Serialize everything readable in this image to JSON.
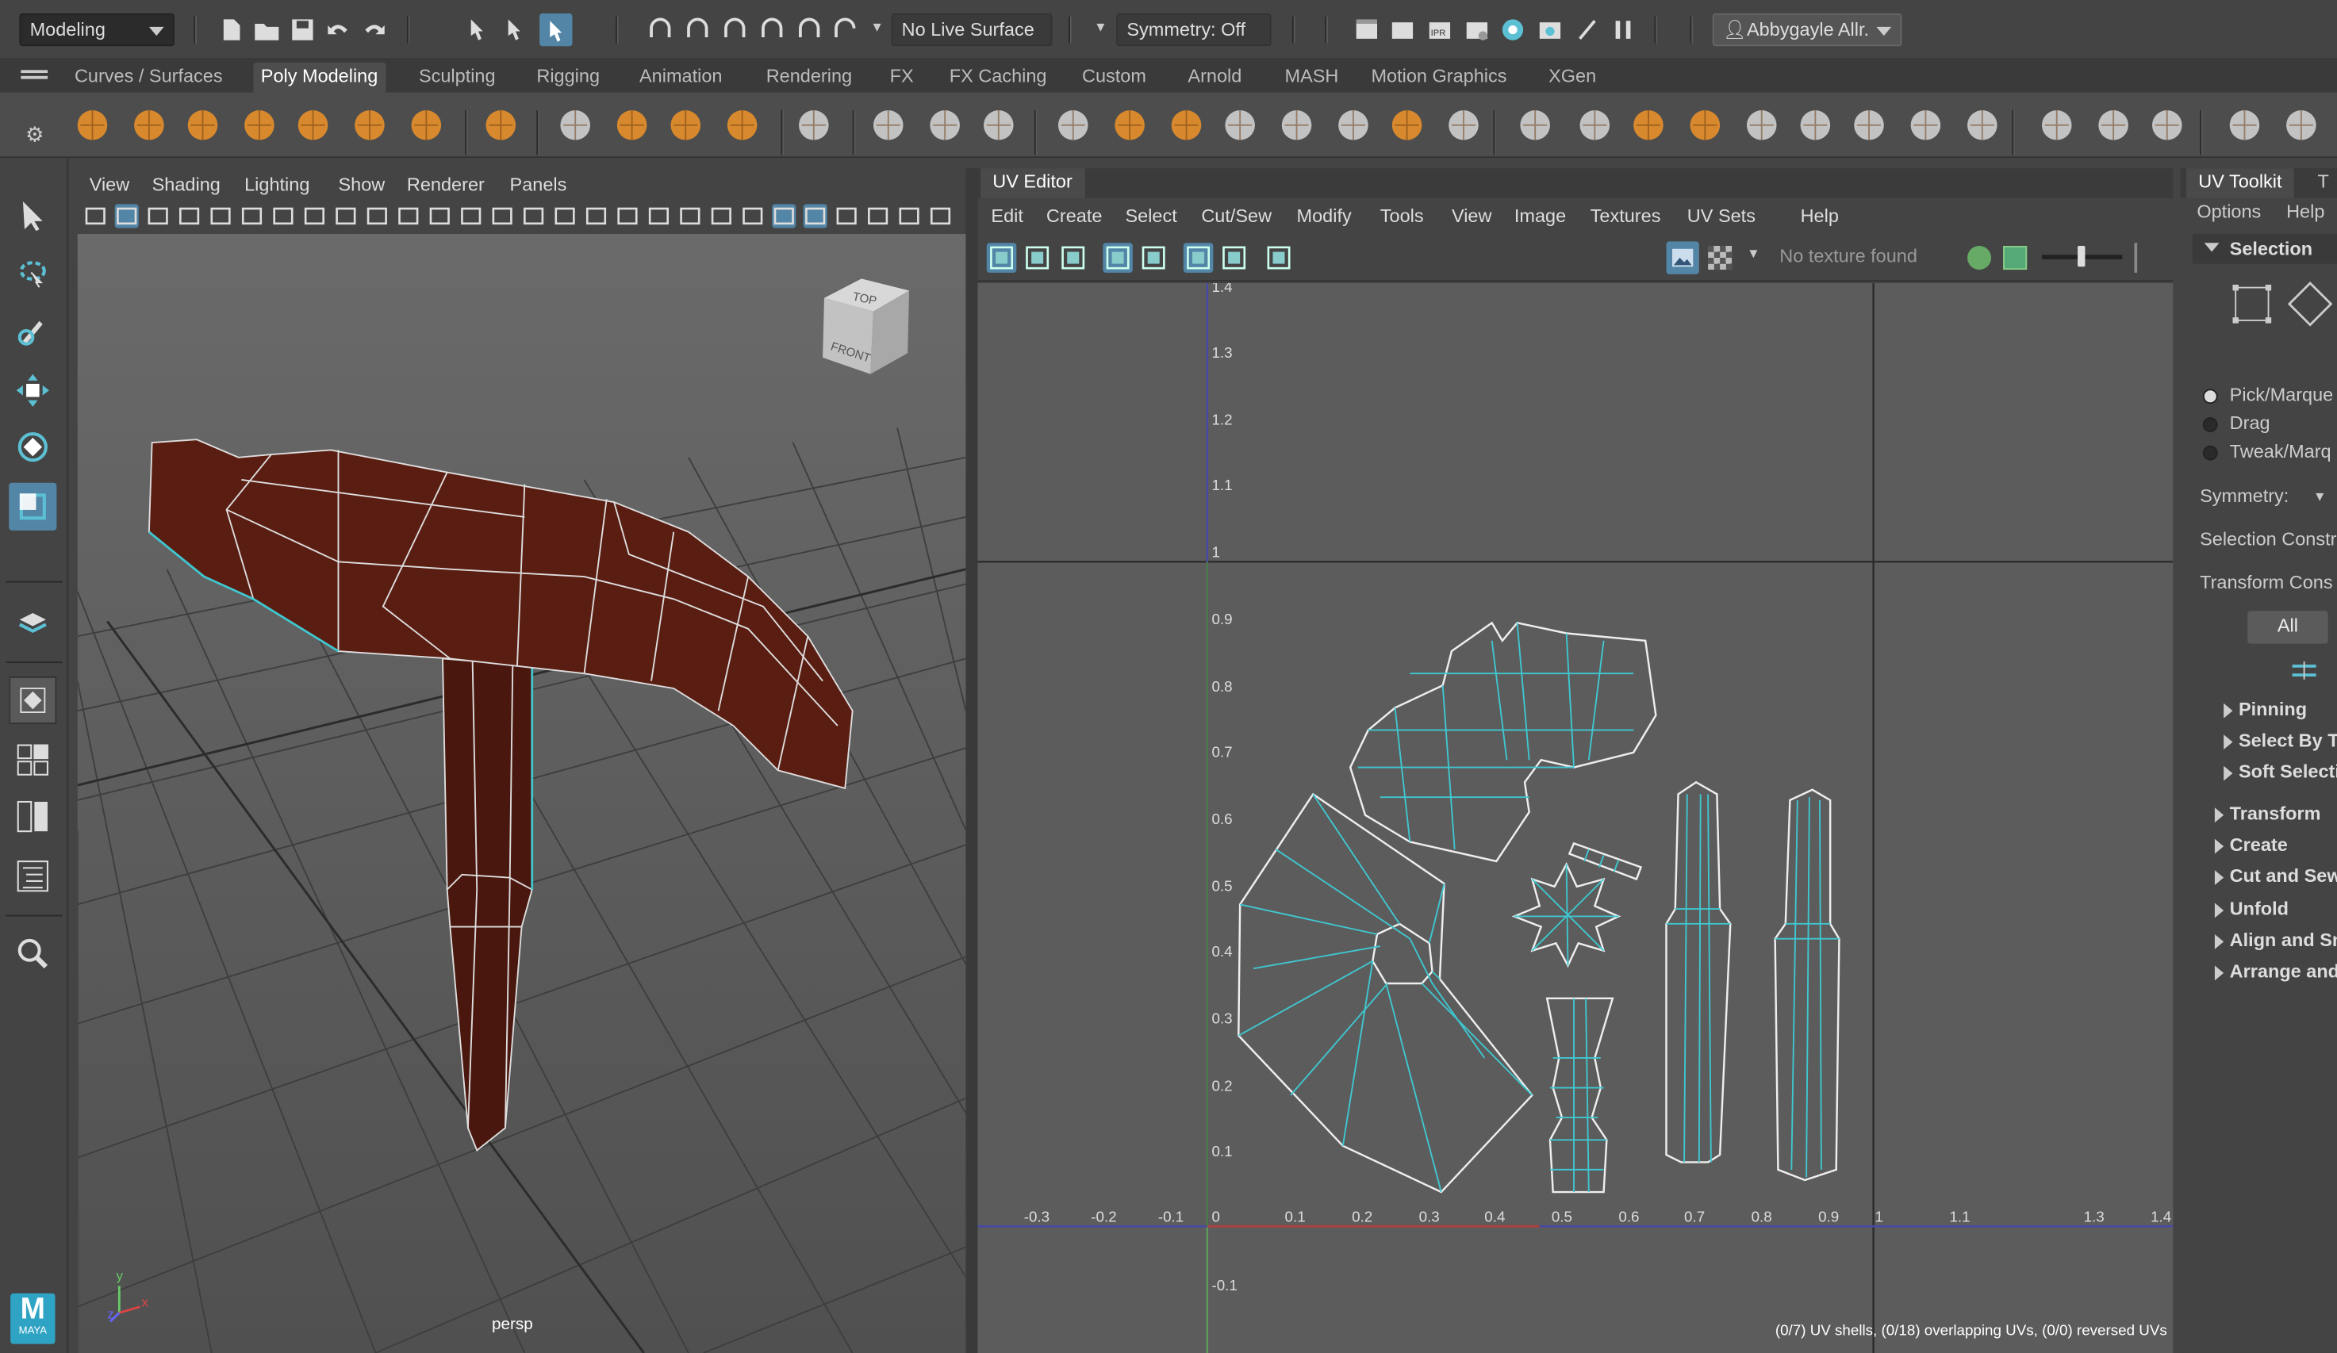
{
  "statusline": {
    "mode": "Modeling",
    "live_surface": "No Live Surface",
    "symmetry": "Symmetry: Off",
    "user": "Abbygayle Allr."
  },
  "shelf_tabs": [
    "Curves / Surfaces",
    "Poly Modeling",
    "Sculpting",
    "Rigging",
    "Animation",
    "Rendering",
    "FX",
    "FX Caching",
    "Custom",
    "Arnold",
    "MASH",
    "Motion Graphics",
    "XGen"
  ],
  "active_shelf": "Poly Modeling",
  "viewport": {
    "menus": [
      "View",
      "Shading",
      "Lighting",
      "Show",
      "Renderer",
      "Panels"
    ],
    "camera": "persp",
    "viewcube_top": "TOP",
    "viewcube_front": "FRONT",
    "axis_x": "x",
    "axis_y": "y",
    "axis_z": "z"
  },
  "uv_editor": {
    "title": "UV Editor",
    "menus": [
      "Edit",
      "Create",
      "Select",
      "Cut/Sew",
      "Modify",
      "Tools",
      "View",
      "Image",
      "Textures",
      "UV Sets",
      "Help"
    ],
    "texture": "No texture found",
    "status": "(0/7) UV shells, (0/18) overlapping UVs, (0/0) reversed UVs",
    "x_ticks": [
      "-0.3",
      "-0.2",
      "-0.1",
      "0",
      "0.1",
      "0.2",
      "0.3",
      "0.4",
      "0.5",
      "0.6",
      "0.7",
      "0.8",
      "0.9",
      "1",
      "1.1",
      "1.3",
      "1.4"
    ],
    "y_ticks": [
      "1.4",
      "1.3",
      "1.2",
      "1.1",
      "1",
      "0.9",
      "0.8",
      "0.7",
      "0.6",
      "0.5",
      "0.4",
      "0.3",
      "0.2",
      "0.1",
      "-0.1"
    ]
  },
  "uv_toolkit": {
    "tabs": [
      "UV Toolkit",
      "T"
    ],
    "menus": [
      "Options",
      "Help"
    ],
    "selection_header": "Selection",
    "pick_options": [
      "Pick/Marque",
      "Drag",
      "Tweak/Marq"
    ],
    "symmetry": "Symmetry:",
    "selection_constraint": "Selection Constr",
    "transform_constraint": "Transform Cons",
    "all_button": "All",
    "subsections": [
      "Pinning",
      "Select By T",
      "Soft Selecti"
    ],
    "sections": [
      "Transform",
      "Create",
      "Cut and Sew",
      "Unfold",
      "Align and Sn",
      "Arrange and"
    ]
  },
  "colors": {
    "mesh": "#5a1d12",
    "uv_line": "#3fc7d0",
    "accent": "#5285a6"
  },
  "logo": "MAYA"
}
